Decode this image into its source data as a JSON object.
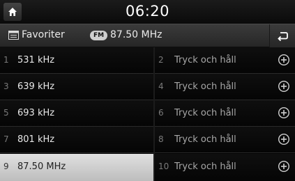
{
  "header": {
    "time": "06:20"
  },
  "subheader": {
    "title": "Favoriter",
    "band_badge": "FM",
    "frequency": "87.50 MHz"
  },
  "presets": [
    {
      "num": "1",
      "label": "531 kHz"
    },
    {
      "num": "2",
      "label": "Tryck och håll"
    },
    {
      "num": "3",
      "label": "639 kHz"
    },
    {
      "num": "4",
      "label": "Tryck och håll"
    },
    {
      "num": "5",
      "label": "693 kHz"
    },
    {
      "num": "6",
      "label": "Tryck och håll"
    },
    {
      "num": "7",
      "label": "801 kHz"
    },
    {
      "num": "8",
      "label": "Tryck och håll"
    },
    {
      "num": "9",
      "label": "87.50 MHz"
    },
    {
      "num": "10",
      "label": "Tryck och håll"
    }
  ],
  "colors": {
    "selected_background": "#d0d0d0",
    "background": "#000000"
  },
  "icons": {
    "home": "home-icon",
    "favorites": "favorites-list-icon",
    "back": "back-arrow-icon",
    "add": "plus-circle-icon"
  }
}
